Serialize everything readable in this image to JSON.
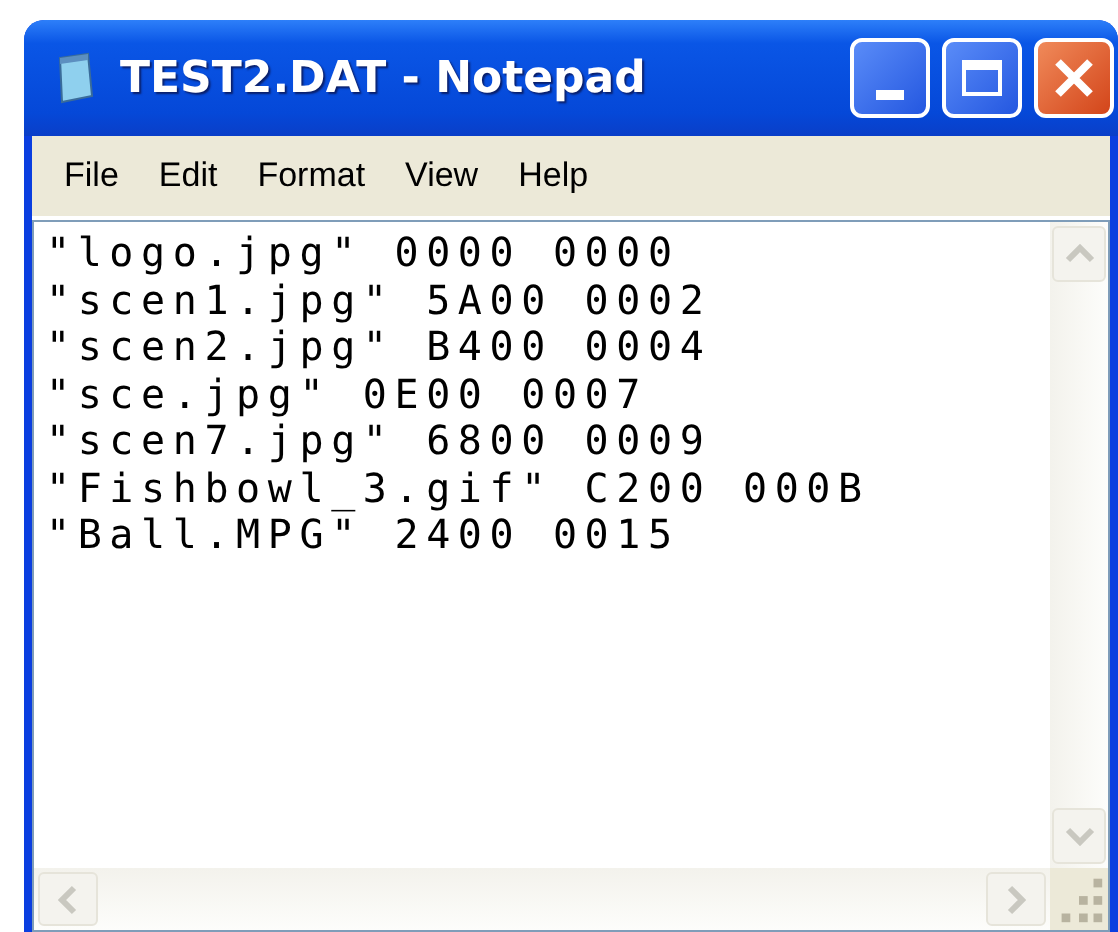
{
  "window": {
    "title": "TEST2.DAT - Notepad"
  },
  "menu": [
    "File",
    "Edit",
    "Format",
    "View",
    "Help"
  ],
  "lines": [
    "\"logo.jpg\" 0000 0000",
    "\"scen1.jpg\" 5A00 0002",
    "\"scen2.jpg\" B400 0004",
    "\"sce.jpg\" 0E00 0007",
    "\"scen7.jpg\" 6800 0009",
    "\"Fishbowl_3.gif\" C200 000B",
    "\"Ball.MPG\" 2400 0015"
  ]
}
